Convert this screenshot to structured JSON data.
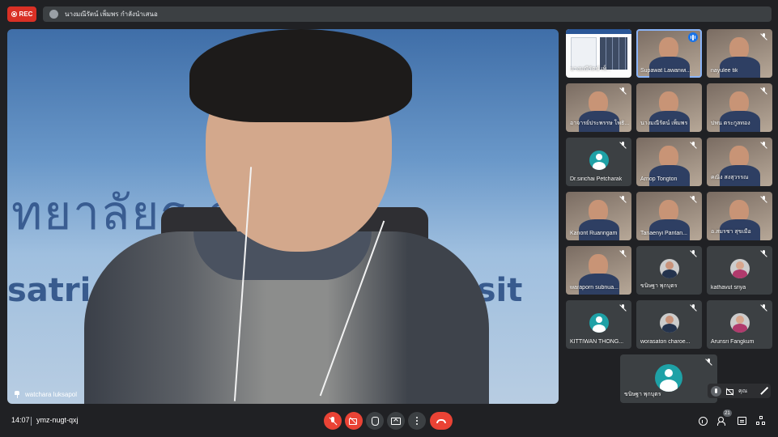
{
  "recording": {
    "label": "REC",
    "color": "#d93025"
  },
  "presenter_bar": {
    "text": "นางมณีรัตน์ เพ็มพร กำลังนำเสนอ"
  },
  "main_speaker": {
    "name": "watchara luksapol",
    "banner_thai": "ทยาลัยร   ภเทพส",
    "banner_en_left": "satri",
    "banner_en_right": "rsit"
  },
  "participants": [
    {
      "name": "นางมณีรัตน์ เพ็...",
      "video": "screen-share",
      "muted": false
    },
    {
      "name": "Supawat Lawanwi...",
      "video": "camera",
      "muted": false,
      "speaking": true
    },
    {
      "name": "nayulee tik",
      "video": "camera",
      "muted": true
    },
    {
      "name": "อาจารย์ประพรรษ โพธิ...",
      "video": "camera",
      "muted": true
    },
    {
      "name": "นางมณีรัตน์ เพ็มพร",
      "video": "camera",
      "muted": false
    },
    {
      "name": "ปพน ตระกูลทอง",
      "video": "camera",
      "muted": true
    },
    {
      "name": "Dr.sirichai Petcharak",
      "video": "avatar",
      "muted": true
    },
    {
      "name": "Arnop Tongton",
      "video": "camera",
      "muted": true
    },
    {
      "name": "คณิง สงสุวรรณ",
      "video": "camera",
      "muted": true
    },
    {
      "name": "Kanont Ruanngam",
      "video": "camera",
      "muted": true
    },
    {
      "name": "Tanaenyi Pantan...",
      "video": "camera",
      "muted": true
    },
    {
      "name": "อ.สมรชา สุขเมือ",
      "video": "camera",
      "muted": true
    },
    {
      "name": "waraporn subnua...",
      "video": "camera",
      "muted": true
    },
    {
      "name": "ขนิษฐา พุกบุตร",
      "video": "avatar",
      "muted": true
    },
    {
      "name": "kathavut sriya",
      "video": "avatar",
      "muted": true
    },
    {
      "name": "KITTIWAN THONG...",
      "video": "avatar",
      "muted": true
    },
    {
      "name": "worasaton charoe...",
      "video": "avatar",
      "muted": true
    },
    {
      "name": "Arunsri Fangkum",
      "video": "avatar",
      "muted": true
    }
  ],
  "solo_tile": {
    "name": "ขนิษฐา พุกบุตร",
    "muted": true
  },
  "self_view": {
    "label": "คุณ"
  },
  "bottom": {
    "time": "14:07",
    "meeting_code": "ymz-nugt-qxj",
    "participant_count": "21"
  },
  "icons": {
    "mic": "mic-off-icon",
    "camera": "camera-off-icon",
    "hand": "raise-hand-icon",
    "present": "present-screen-icon",
    "more": "more-options-icon",
    "leave": "hangup-icon",
    "info": "info-icon",
    "people": "people-icon",
    "chat": "chat-icon",
    "activities": "activities-icon"
  },
  "colors": {
    "background": "#202124",
    "tile": "#3c4043",
    "danger": "#ea4335",
    "active_speaker": "#8ab4f8",
    "avatar_teal": "#1ea1a6"
  }
}
